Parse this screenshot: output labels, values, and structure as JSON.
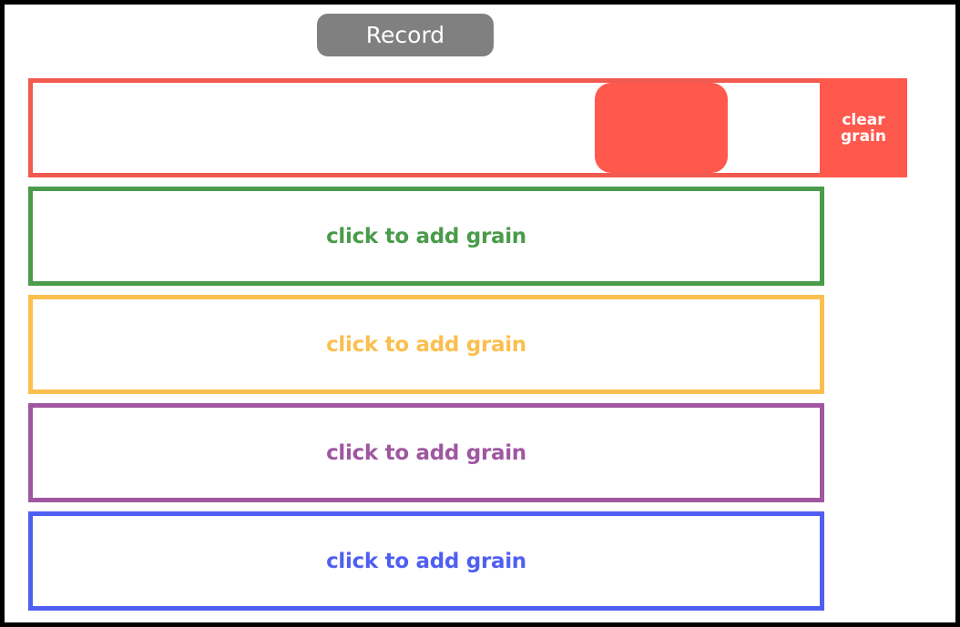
{
  "record_button": {
    "label": "Record",
    "color": "#808080"
  },
  "lanes": [
    {
      "color": "#f15a4f",
      "label": ""
    },
    {
      "color": "#4a9b4a",
      "label": "click to add grain"
    },
    {
      "color": "#fbbf4f",
      "label": "click to add grain"
    },
    {
      "color": "#9f57a0",
      "label": "click to add grain"
    },
    {
      "color": "#4f5ff1",
      "label": "click to add grain"
    }
  ],
  "grain": {
    "color": "#ff584d"
  },
  "clear_button": {
    "label_line1": "clear",
    "label_line2": "grain",
    "color": "#ff584d"
  }
}
